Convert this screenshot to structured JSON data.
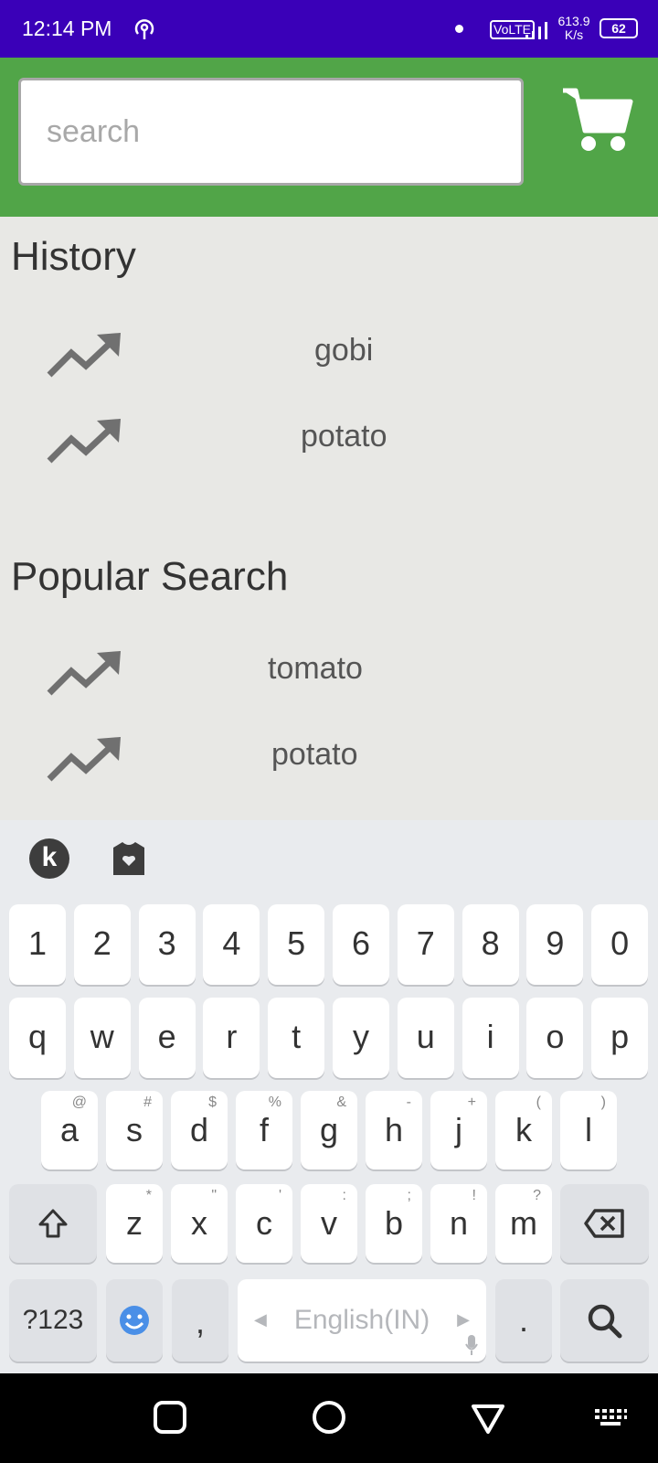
{
  "status_bar": {
    "time": "12:14 PM",
    "network_type": "VoLTE",
    "speed_value": "613.9",
    "speed_unit": "K/s",
    "battery": "62"
  },
  "header": {
    "search_placeholder": "search",
    "cart_icon": "shopping-cart-icon"
  },
  "history": {
    "title": "History",
    "items": [
      {
        "label": "gobi"
      },
      {
        "label": "potato"
      }
    ]
  },
  "popular": {
    "title": "Popular Search",
    "items": [
      {
        "label": "tomato"
      },
      {
        "label": "potato"
      }
    ]
  },
  "keyboard": {
    "toolbar": {
      "k_label": "k"
    },
    "number_row": [
      "1",
      "2",
      "3",
      "4",
      "5",
      "6",
      "7",
      "8",
      "9",
      "0"
    ],
    "row1": [
      "q",
      "w",
      "e",
      "r",
      "t",
      "y",
      "u",
      "i",
      "o",
      "p"
    ],
    "row2": [
      {
        "k": "a",
        "h": "@"
      },
      {
        "k": "s",
        "h": "#"
      },
      {
        "k": "d",
        "h": "$"
      },
      {
        "k": "f",
        "h": "%"
      },
      {
        "k": "g",
        "h": "&"
      },
      {
        "k": "h",
        "h": "-"
      },
      {
        "k": "j",
        "h": "+"
      },
      {
        "k": "k",
        "h": "("
      },
      {
        "k": "l",
        "h": ")"
      }
    ],
    "row3": [
      {
        "k": "z",
        "h": "*"
      },
      {
        "k": "x",
        "h": "\""
      },
      {
        "k": "c",
        "h": "'"
      },
      {
        "k": "v",
        "h": ":"
      },
      {
        "k": "b",
        "h": ";"
      },
      {
        "k": "n",
        "h": "!"
      },
      {
        "k": "m",
        "h": "?"
      }
    ],
    "symbols_label": "?123",
    "comma_label": ",",
    "space_label": "English(IN)",
    "period_label": "."
  },
  "colors": {
    "status_bar": "#3a00b8",
    "header_green": "#51a548",
    "background": "#e8e8e5"
  }
}
